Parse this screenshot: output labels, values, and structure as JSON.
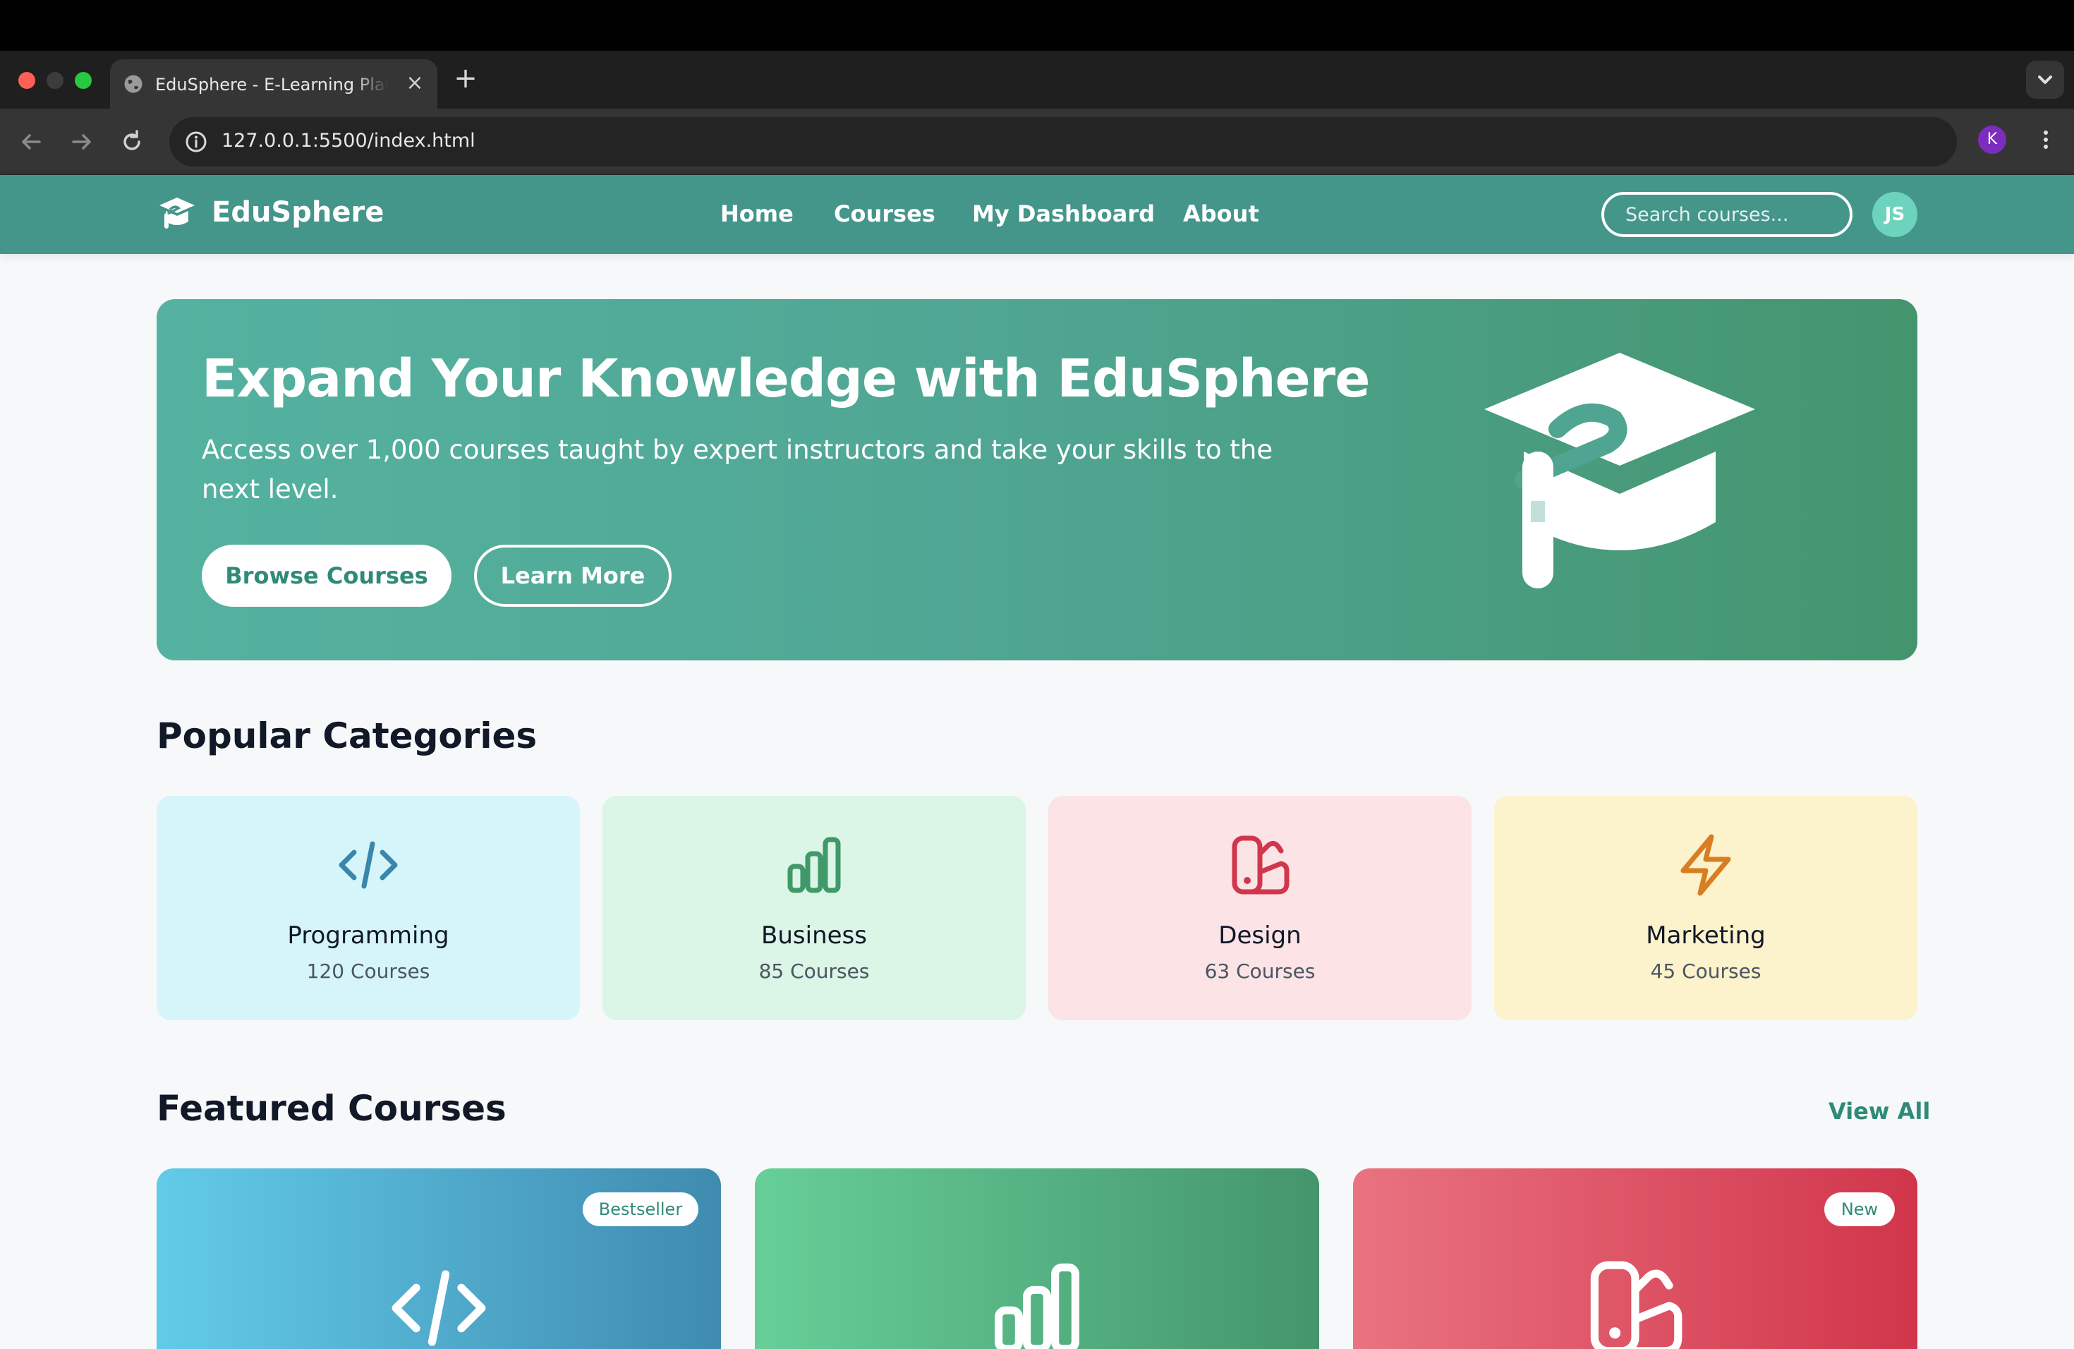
{
  "browser": {
    "tab_title": "EduSphere - E-Learning Platform",
    "url": "127.0.0.1:5500/index.html",
    "profile_initial": "K",
    "close_glyph": "×",
    "new_tab_glyph": "+"
  },
  "header": {
    "brand": "EduSphere",
    "nav": [
      "Home",
      "Courses",
      "My Dashboard",
      "About"
    ],
    "search_placeholder": "Search courses...",
    "user_initials": "JS"
  },
  "hero": {
    "title": "Expand Your Knowledge with EduSphere",
    "subtitle": "Access over 1,000 courses taught by expert instructors and take your skills to the next level.",
    "primary_button": "Browse Courses",
    "secondary_button": "Learn More"
  },
  "categories": {
    "title": "Popular Categories",
    "items": [
      {
        "name": "Programming",
        "count": "120 Courses",
        "icon": "code-icon",
        "bg": "#d6f5fb",
        "color": "#3b86ad"
      },
      {
        "name": "Business",
        "count": "85 Courses",
        "icon": "bar-chart-icon",
        "bg": "#dbf5e6",
        "color": "#3f9968"
      },
      {
        "name": "Design",
        "count": "63 Courses",
        "icon": "palette-swatch-icon",
        "bg": "#fbe3e6",
        "color": "#d0374c"
      },
      {
        "name": "Marketing",
        "count": "45 Courses",
        "icon": "lightning-icon",
        "bg": "#fcf2cb",
        "color": "#d77d22"
      }
    ]
  },
  "featured": {
    "title": "Featured Courses",
    "view_all": "View All",
    "courses": [
      {
        "badge": "Bestseller",
        "icon": "code-icon",
        "badge_color": "#2f8a78"
      },
      {
        "badge": "",
        "icon": "bar-chart-icon",
        "badge_color": "#2f8a78"
      },
      {
        "badge": "New",
        "icon": "palette-swatch-icon",
        "badge_color": "#2f8a78"
      }
    ]
  },
  "colors": {
    "header": "#44958a",
    "accent": "#2f8a78",
    "programming_gradient": [
      "#62cbe8",
      "#3f8bb0"
    ],
    "business_gradient": [
      "#66cf98",
      "#44956c"
    ],
    "design_gradient": [
      "#e9737f",
      "#d1354c"
    ]
  }
}
